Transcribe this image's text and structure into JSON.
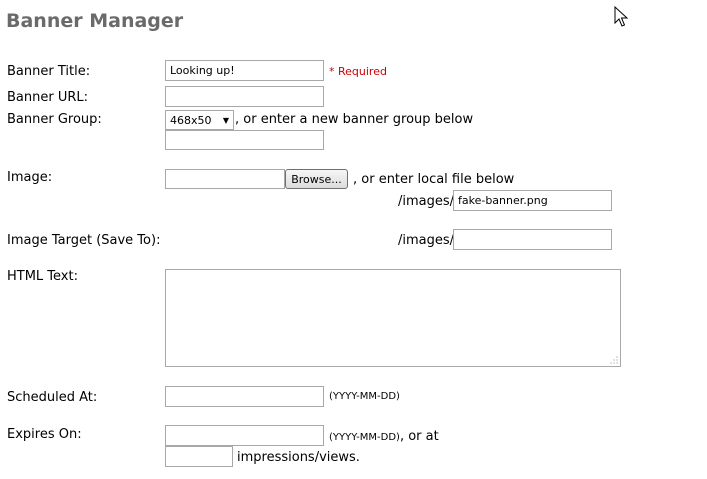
{
  "page_title": "Banner Manager",
  "fields": {
    "banner_title": {
      "label": "Banner Title:",
      "value": "Looking up!",
      "required_text": "* Required"
    },
    "banner_url": {
      "label": "Banner URL:",
      "value": ""
    },
    "banner_group": {
      "label": "Banner Group:",
      "selected": "468x50",
      "hint": ", or enter a new banner group below",
      "new_group_value": ""
    },
    "image": {
      "label": "Image:",
      "file_value": "",
      "browse_label": "Browse...",
      "hint": ", or enter local file below",
      "local_prefix": "/images/",
      "local_value": "fake-banner.png"
    },
    "image_target": {
      "label": "Image Target (Save To):",
      "prefix": "/images/",
      "value": ""
    },
    "html_text": {
      "label": "HTML Text:",
      "value": ""
    },
    "scheduled_at": {
      "label": "Scheduled At:",
      "value": "",
      "format_hint": "(YYYY-MM-DD)"
    },
    "expires_on": {
      "label": "Expires On:",
      "value": "",
      "format_hint": "(YYYY-MM-DD)",
      "or_at": ", or at",
      "impressions_value": "",
      "impressions_suffix": "impressions/views."
    }
  },
  "icons": {
    "cursor": "mouse-pointer-icon",
    "resize": "resize-grip-icon"
  }
}
